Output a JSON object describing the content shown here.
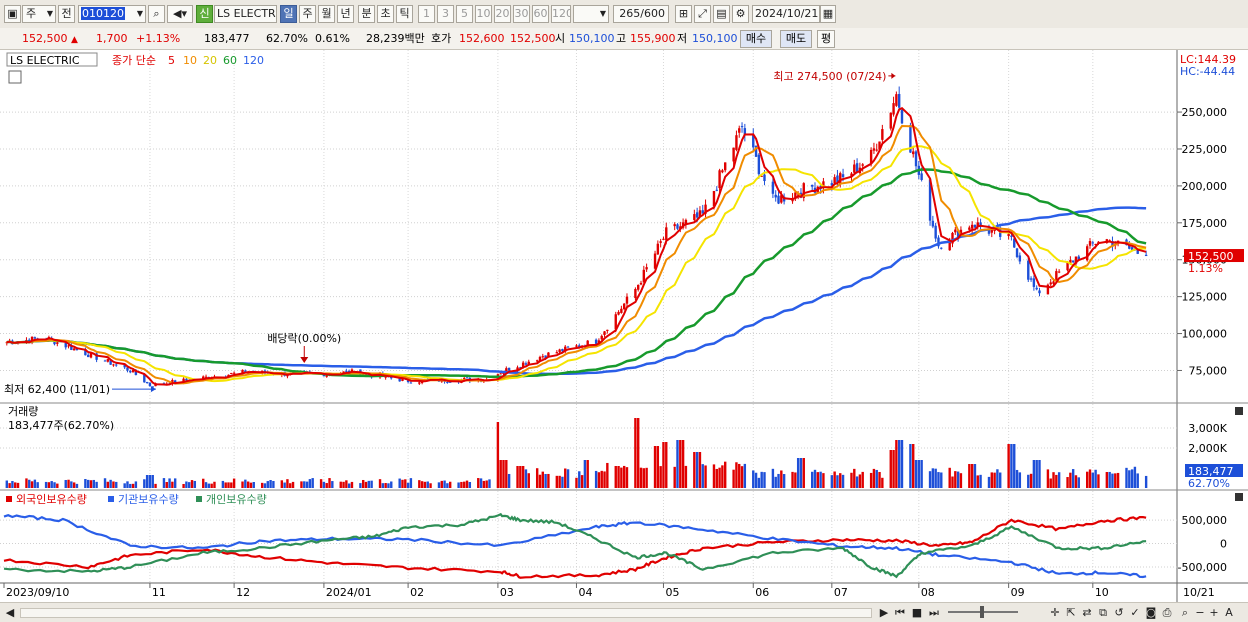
{
  "toolbar": {
    "market": "주",
    "mode": "전",
    "code": "010120",
    "credit": "신",
    "stock_name": "LS ELECTRI",
    "periods": [
      "일",
      "주",
      "월",
      "년",
      "분",
      "초",
      "틱"
    ],
    "active_period": "일",
    "minute_options": [
      "1",
      "3",
      "5",
      "10",
      "20",
      "30",
      "60",
      "120"
    ],
    "count": "265",
    "count_max": "/600",
    "date": "2024/10/21"
  },
  "infobar": {
    "price": "152,500",
    "change": "1,700",
    "change_pct": "+1.13%",
    "volume": "183,477",
    "vol_ratio": "62.70%",
    "turnover_ratio": "0.61%",
    "amount": "28,239백만",
    "bid_label": "호가",
    "bid1": "152,600",
    "bid2": "152,500",
    "open_label": "시",
    "open": "150,100",
    "high_label": "고",
    "high": "155,900",
    "low_label": "저",
    "low": "150,100",
    "buy_label": "매수",
    "sell_label": "매도",
    "eval_label": "평"
  },
  "colors": {
    "up": "#e00000",
    "down": "#1d4fd8",
    "ma5": "#e00000",
    "ma10": "#f08c00",
    "ma20": "#f5e400",
    "ma60": "#179a2c",
    "ma120": "#2a5ee8",
    "foreign": "#e00000",
    "institution": "#2a5ee8",
    "individual": "#2f8f57"
  },
  "chart_data": [
    {
      "type": "candlestick",
      "title": "LS ELECTRIC",
      "legend": {
        "label": "종가 단순",
        "periods": [
          "5",
          "10",
          "20",
          "60",
          "120"
        ]
      },
      "ylim": [
        55000,
        290000
      ],
      "yticks": [
        75000,
        100000,
        125000,
        150000,
        175000,
        200000,
        225000,
        250000
      ],
      "ytick_labels": [
        "75,000",
        "100,000",
        "125,000",
        "150,000",
        "175,000",
        "200,000",
        "225,000",
        "250,000"
      ],
      "date_range": [
        "2023/09/10",
        "2024/10/21"
      ],
      "keypoints": [
        [
          "2023-09-10",
          94000
        ],
        [
          "2023-09-25",
          97000
        ],
        [
          "2023-10-10",
          86000
        ],
        [
          "2023-10-25",
          75000
        ],
        [
          "2023-11-01",
          65000
        ],
        [
          "2023-11-20",
          70000
        ],
        [
          "2023-12-05",
          74000
        ],
        [
          "2023-12-26",
          72000
        ],
        [
          "2024-01-12",
          74000
        ],
        [
          "2024-02-01",
          68000
        ],
        [
          "2024-02-29",
          69000
        ],
        [
          "2024-03-05",
          74000
        ],
        [
          "2024-03-20",
          85000
        ],
        [
          "2024-04-08",
          95000
        ],
        [
          "2024-04-22",
          130000
        ],
        [
          "2024-05-03",
          168000
        ],
        [
          "2024-05-16",
          180000
        ],
        [
          "2024-05-30",
          240000
        ],
        [
          "2024-06-10",
          190000
        ],
        [
          "2024-06-25",
          200000
        ],
        [
          "2024-07-05",
          205000
        ],
        [
          "2024-07-15",
          220000
        ],
        [
          "2024-07-24",
          262000
        ],
        [
          "2024-08-02",
          200000
        ],
        [
          "2024-08-08",
          160000
        ],
        [
          "2024-08-20",
          175000
        ],
        [
          "2024-09-03",
          163000
        ],
        [
          "2024-09-12",
          127000
        ],
        [
          "2024-09-25",
          150000
        ],
        [
          "2024-10-05",
          165000
        ],
        [
          "2024-10-21",
          152500
        ]
      ],
      "annotations": {
        "high": {
          "label": "최고 274,500 (07/24)",
          "date": "2024-07-24",
          "value": 274500
        },
        "low": {
          "label": "최저 62,400 (11/01)",
          "date": "2023-11-01",
          "value": 62400
        },
        "dividend": {
          "label": "배당락(0.00%)",
          "date": "2023-12-26"
        },
        "current": {
          "value": "152,500",
          "change_pct": "1.13%"
        },
        "lc": "LC:144.39",
        "hc": "HC:-44.44"
      }
    },
    {
      "type": "bar",
      "title": "거래량",
      "value_label": "183,477주(62.70%)",
      "yticks": [
        2000,
        3000
      ],
      "ytick_labels": [
        "2,000K",
        "3,000K"
      ],
      "ylim": [
        0,
        4000
      ],
      "current": {
        "value": "183,477",
        "pct": "62.70%"
      },
      "spikes": [
        [
          "2023-11-01",
          650
        ],
        [
          "2024-03-05",
          3300
        ],
        [
          "2024-03-06",
          1400
        ],
        [
          "2024-03-12",
          1100
        ],
        [
          "2024-04-05",
          1400
        ],
        [
          "2024-04-15",
          1100
        ],
        [
          "2024-04-22",
          3500
        ],
        [
          "2024-04-29",
          2100
        ],
        [
          "2024-05-03",
          2300
        ],
        [
          "2024-05-08",
          2400
        ],
        [
          "2024-05-14",
          1800
        ],
        [
          "2024-06-20",
          1500
        ],
        [
          "2024-07-23",
          1900
        ],
        [
          "2024-07-25",
          2400
        ],
        [
          "2024-07-29",
          2200
        ],
        [
          "2024-08-01",
          1400
        ],
        [
          "2024-08-20",
          1200
        ],
        [
          "2024-09-03",
          2200
        ],
        [
          "2024-09-12",
          1400
        ]
      ]
    },
    {
      "type": "line",
      "series": [
        {
          "name": "외국인보유수량",
          "points": [
            [
              "2023-09-10",
              -350000
            ],
            [
              "2023-10-10",
              -500000
            ],
            [
              "2023-10-25",
              -250000
            ],
            [
              "2023-11-20",
              -120000
            ],
            [
              "2023-12-10",
              -280000
            ],
            [
              "2024-01-05",
              -420000
            ],
            [
              "2024-02-01",
              -520000
            ],
            [
              "2024-03-05",
              -600000
            ],
            [
              "2024-03-12",
              -700000
            ],
            [
              "2024-04-08",
              -680000
            ],
            [
              "2024-04-22",
              -550000
            ],
            [
              "2024-05-03",
              -300000
            ],
            [
              "2024-05-16",
              -100000
            ],
            [
              "2024-06-10",
              30000
            ],
            [
              "2024-07-05",
              80000
            ],
            [
              "2024-07-24",
              60000
            ],
            [
              "2024-08-08",
              -50000
            ],
            [
              "2024-08-20",
              30000
            ],
            [
              "2024-09-03",
              500000
            ],
            [
              "2024-09-20",
              300000
            ],
            [
              "2024-10-05",
              480000
            ],
            [
              "2024-10-21",
              550000
            ]
          ]
        },
        {
          "name": "기관보유수량",
          "points": [
            [
              "2023-09-10",
              600000
            ],
            [
              "2023-10-01",
              500000
            ],
            [
              "2023-10-25",
              -50000
            ],
            [
              "2023-11-20",
              -100000
            ],
            [
              "2023-12-10",
              50000
            ],
            [
              "2024-01-05",
              100000
            ],
            [
              "2024-02-01",
              90000
            ],
            [
              "2024-03-05",
              -50000
            ],
            [
              "2024-04-08",
              350000
            ],
            [
              "2024-04-22",
              450000
            ],
            [
              "2024-05-16",
              300000
            ],
            [
              "2024-06-10",
              100000
            ],
            [
              "2024-07-05",
              -60000
            ],
            [
              "2024-07-24",
              -100000
            ],
            [
              "2024-08-08",
              -250000
            ],
            [
              "2024-09-03",
              -400000
            ],
            [
              "2024-09-20",
              -650000
            ],
            [
              "2024-10-05",
              -620000
            ],
            [
              "2024-10-21",
              -700000
            ]
          ]
        },
        {
          "name": "개인보유수량",
          "points": [
            [
              "2023-09-10",
              -550000
            ],
            [
              "2023-10-10",
              -600000
            ],
            [
              "2023-10-25",
              -500000
            ],
            [
              "2023-11-20",
              -200000
            ],
            [
              "2023-12-10",
              -100000
            ],
            [
              "2024-01-05",
              80000
            ],
            [
              "2024-01-20",
              150000
            ],
            [
              "2024-02-01",
              350000
            ],
            [
              "2024-02-20",
              400000
            ],
            [
              "2024-03-05",
              600000
            ],
            [
              "2024-03-12",
              500000
            ],
            [
              "2024-03-25",
              450000
            ],
            [
              "2024-04-08",
              100000
            ],
            [
              "2024-04-22",
              -300000
            ],
            [
              "2024-05-03",
              -200000
            ],
            [
              "2024-05-16",
              -550000
            ],
            [
              "2024-06-10",
              -200000
            ],
            [
              "2024-07-05",
              -100000
            ],
            [
              "2024-07-15",
              -500000
            ],
            [
              "2024-07-24",
              -700000
            ],
            [
              "2024-08-02",
              -200000
            ],
            [
              "2024-08-20",
              -50000
            ],
            [
              "2024-09-03",
              350000
            ],
            [
              "2024-09-20",
              -100000
            ],
            [
              "2024-10-05",
              -100000
            ],
            [
              "2024-10-21",
              50000
            ]
          ]
        }
      ],
      "yticks": [
        -500000,
        0,
        500000
      ],
      "ytick_labels": [
        "-500,000",
        "0",
        "500,000"
      ],
      "ylim": [
        -800000,
        800000
      ]
    }
  ],
  "xaxis": {
    "labels": [
      [
        "2023-09-10",
        "2023/09/10"
      ],
      [
        "2023-11-01",
        "11"
      ],
      [
        "2023-12-01",
        "12"
      ],
      [
        "2024-01-02",
        "2024/01"
      ],
      [
        "2024-02-01",
        "02"
      ],
      [
        "2024-03-04",
        "03"
      ],
      [
        "2024-04-01",
        "04"
      ],
      [
        "2024-05-02",
        "05"
      ],
      [
        "2024-06-03",
        "06"
      ],
      [
        "2024-07-01",
        "07"
      ],
      [
        "2024-08-01",
        "08"
      ],
      [
        "2024-09-02",
        "09"
      ],
      [
        "2024-10-02",
        "10"
      ],
      [
        "2024-11-01",
        "10/21"
      ]
    ]
  }
}
